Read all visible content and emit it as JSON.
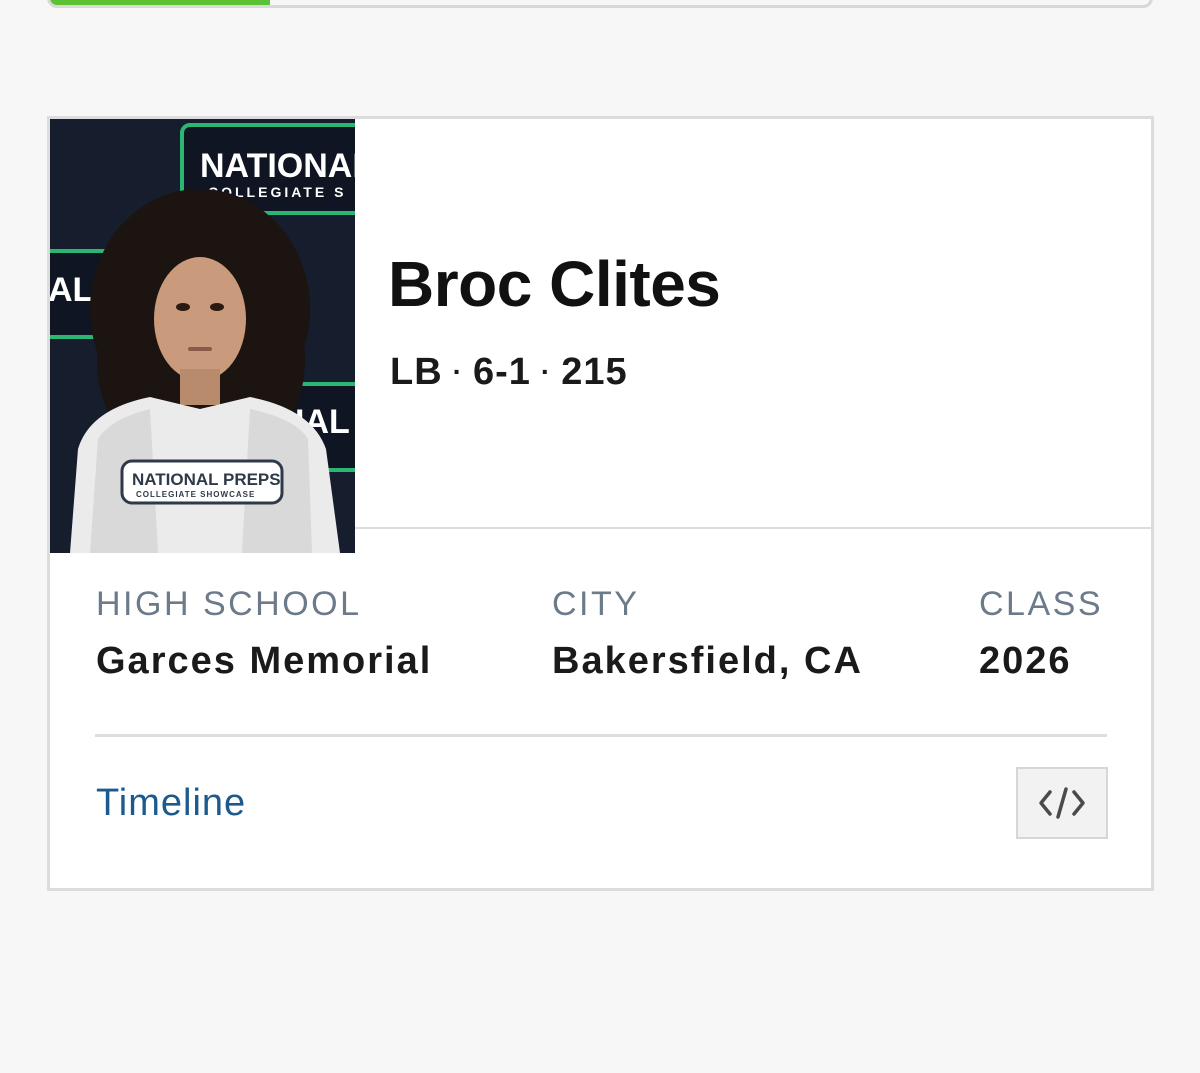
{
  "progress": {
    "fraction": 0.2
  },
  "player": {
    "name": "Broc Clites",
    "position": "LB",
    "height": "6-1",
    "weight": "215",
    "separator": "·",
    "photo_logo_banner": "NATIONAL",
    "photo_logo_sub": "COLLEGIATE S",
    "photo_shirt_line1": "NATIONAL PREPS",
    "photo_shirt_line2": "COLLEGIATE SHOWCASE"
  },
  "info": {
    "high_school_label": "HIGH SCHOOL",
    "high_school_value": "Garces Memorial",
    "city_label": "CITY",
    "city_value": "Bakersfield, CA",
    "class_label": "CLASS",
    "class_value": "2026"
  },
  "footer": {
    "timeline_label": "Timeline",
    "embed_icon": "code-icon"
  },
  "colors": {
    "progress": "#5bc236",
    "link": "#1b5a8e",
    "label": "#6c7a8a",
    "photo_bg": "#161d2c",
    "logo_green": "#2bb673"
  }
}
